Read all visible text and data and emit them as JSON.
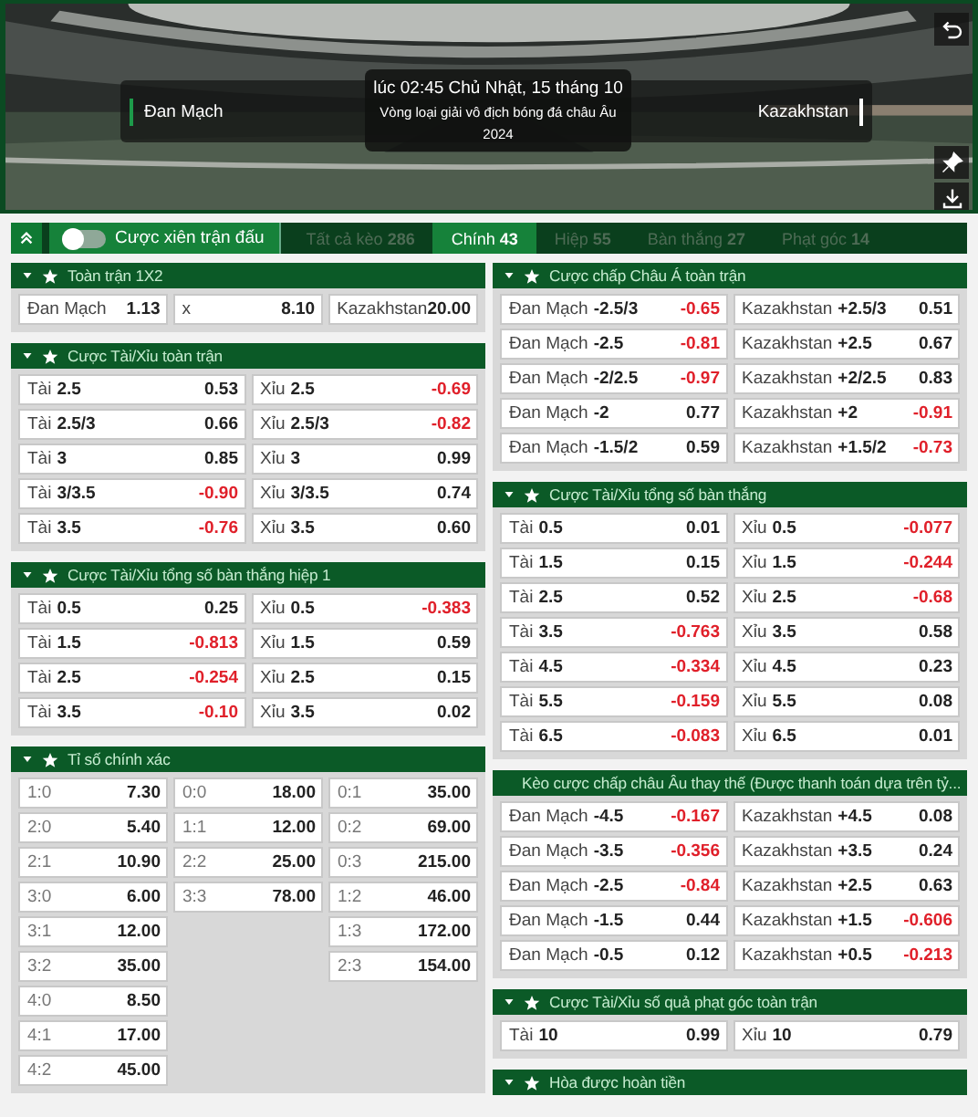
{
  "match": {
    "home": "Đan Mạch",
    "away": "Kazakhstan",
    "time": "lúc 02:45 Chủ Nhật, 15 tháng 10",
    "competition": "Vòng loại giải vô địch bóng đá châu Âu",
    "season": "2024"
  },
  "toolbar": {
    "parlay_label": "Cược xiên trận đấu",
    "parlay_on": false
  },
  "tabs": [
    {
      "label": "Tất cả kèo",
      "count": "286",
      "selected": false
    },
    {
      "label": "Chính",
      "count": "43",
      "selected": true
    },
    {
      "label": "Hiệp",
      "count": "55",
      "selected": false
    },
    {
      "label": "Bàn thắng",
      "count": "27",
      "selected": false
    },
    {
      "label": "Phạt góc",
      "count": "14",
      "selected": false
    }
  ],
  "left_column": [
    {
      "title": "Toàn trận 1X2",
      "kind": "triple",
      "cells": [
        {
          "label": "Đan Mạch",
          "odds": "1.13",
          "negative": false
        },
        {
          "label": "x",
          "odds": "8.10",
          "negative": false
        },
        {
          "label": "Kazakhstan",
          "odds": "20.00",
          "negative": false
        }
      ]
    },
    {
      "title": "Cược Tài/Xỉu toàn trận",
      "kind": "pair",
      "cells": [
        {
          "label": "Tài",
          "line": "2.5",
          "odds": "0.53",
          "negative": false
        },
        {
          "label": "Xỉu",
          "line": "2.5",
          "odds": "-0.69",
          "negative": true
        },
        {
          "label": "Tài",
          "line": "2.5/3",
          "odds": "0.66",
          "negative": false
        },
        {
          "label": "Xỉu",
          "line": "2.5/3",
          "odds": "-0.82",
          "negative": true
        },
        {
          "label": "Tài",
          "line": "3",
          "odds": "0.85",
          "negative": false
        },
        {
          "label": "Xỉu",
          "line": "3",
          "odds": "0.99",
          "negative": false
        },
        {
          "label": "Tài",
          "line": "3/3.5",
          "odds": "-0.90",
          "negative": true
        },
        {
          "label": "Xỉu",
          "line": "3/3.5",
          "odds": "0.74",
          "negative": false
        },
        {
          "label": "Tài",
          "line": "3.5",
          "odds": "-0.76",
          "negative": true
        },
        {
          "label": "Xỉu",
          "line": "3.5",
          "odds": "0.60",
          "negative": false
        }
      ]
    },
    {
      "title": "Cược Tài/Xỉu tổng số bàn thắng hiệp 1",
      "kind": "pair",
      "cells": [
        {
          "label": "Tài",
          "line": "0.5",
          "odds": "0.25",
          "negative": false
        },
        {
          "label": "Xỉu",
          "line": "0.5",
          "odds": "-0.383",
          "negative": true
        },
        {
          "label": "Tài",
          "line": "1.5",
          "odds": "-0.813",
          "negative": true
        },
        {
          "label": "Xỉu",
          "line": "1.5",
          "odds": "0.59",
          "negative": false
        },
        {
          "label": "Tài",
          "line": "2.5",
          "odds": "-0.254",
          "negative": true
        },
        {
          "label": "Xỉu",
          "line": "2.5",
          "odds": "0.15",
          "negative": false
        },
        {
          "label": "Tài",
          "line": "3.5",
          "odds": "-0.10",
          "negative": true
        },
        {
          "label": "Xỉu",
          "line": "3.5",
          "odds": "0.02",
          "negative": false
        }
      ]
    },
    {
      "title": "Tỉ số chính xác",
      "kind": "score",
      "score_columns": [
        [
          {
            "label": "1:0",
            "odds": "7.30",
            "negative": false
          },
          {
            "label": "2:0",
            "odds": "5.40",
            "negative": false
          },
          {
            "label": "2:1",
            "odds": "10.90",
            "negative": false
          },
          {
            "label": "3:0",
            "odds": "6.00",
            "negative": false
          },
          {
            "label": "3:1",
            "odds": "12.00",
            "negative": false
          },
          {
            "label": "3:2",
            "odds": "35.00",
            "negative": false
          },
          {
            "label": "4:0",
            "odds": "8.50",
            "negative": false
          },
          {
            "label": "4:1",
            "odds": "17.00",
            "negative": false
          },
          {
            "label": "4:2",
            "odds": "45.00",
            "negative": false
          }
        ],
        [
          {
            "label": "0:0",
            "odds": "18.00",
            "negative": false
          },
          {
            "label": "1:1",
            "odds": "12.00",
            "negative": false
          },
          {
            "label": "2:2",
            "odds": "25.00",
            "negative": false
          },
          {
            "label": "3:3",
            "odds": "78.00",
            "negative": false
          }
        ],
        [
          {
            "label": "0:1",
            "odds": "35.00",
            "negative": false
          },
          {
            "label": "0:2",
            "odds": "69.00",
            "negative": false
          },
          {
            "label": "0:3",
            "odds": "215.00",
            "negative": false
          },
          {
            "label": "1:2",
            "odds": "46.00",
            "negative": false
          },
          {
            "label": "1:3",
            "odds": "172.00",
            "negative": false
          },
          {
            "label": "2:3",
            "odds": "154.00",
            "negative": false
          }
        ]
      ]
    }
  ],
  "right_column": [
    {
      "title": "Cược chấp Châu Á toàn trận",
      "kind": "pair",
      "cells": [
        {
          "label": "Đan Mạch",
          "line": "-2.5/3",
          "odds": "-0.65",
          "negative": true
        },
        {
          "label": "Kazakhstan",
          "line": "+2.5/3",
          "odds": "0.51",
          "negative": false
        },
        {
          "label": "Đan Mạch",
          "line": "-2.5",
          "odds": "-0.81",
          "negative": true
        },
        {
          "label": "Kazakhstan",
          "line": "+2.5",
          "odds": "0.67",
          "negative": false
        },
        {
          "label": "Đan Mạch",
          "line": "-2/2.5",
          "odds": "-0.97",
          "negative": true
        },
        {
          "label": "Kazakhstan",
          "line": "+2/2.5",
          "odds": "0.83",
          "negative": false
        },
        {
          "label": "Đan Mạch",
          "line": "-2",
          "odds": "0.77",
          "negative": false
        },
        {
          "label": "Kazakhstan",
          "line": "+2",
          "odds": "-0.91",
          "negative": true
        },
        {
          "label": "Đan Mạch",
          "line": "-1.5/2",
          "odds": "0.59",
          "negative": false
        },
        {
          "label": "Kazakhstan",
          "line": "+1.5/2",
          "odds": "-0.73",
          "negative": true
        }
      ]
    },
    {
      "title": "Cược Tài/Xỉu tổng số bàn thắng",
      "kind": "pair",
      "cells": [
        {
          "label": "Tài",
          "line": "0.5",
          "odds": "0.01",
          "negative": false
        },
        {
          "label": "Xỉu",
          "line": "0.5",
          "odds": "-0.077",
          "negative": true
        },
        {
          "label": "Tài",
          "line": "1.5",
          "odds": "0.15",
          "negative": false
        },
        {
          "label": "Xỉu",
          "line": "1.5",
          "odds": "-0.244",
          "negative": true
        },
        {
          "label": "Tài",
          "line": "2.5",
          "odds": "0.52",
          "negative": false
        },
        {
          "label": "Xỉu",
          "line": "2.5",
          "odds": "-0.68",
          "negative": true
        },
        {
          "label": "Tài",
          "line": "3.5",
          "odds": "-0.763",
          "negative": true
        },
        {
          "label": "Xỉu",
          "line": "3.5",
          "odds": "0.58",
          "negative": false
        },
        {
          "label": "Tài",
          "line": "4.5",
          "odds": "-0.334",
          "negative": true
        },
        {
          "label": "Xỉu",
          "line": "4.5",
          "odds": "0.23",
          "negative": false
        },
        {
          "label": "Tài",
          "line": "5.5",
          "odds": "-0.159",
          "negative": true
        },
        {
          "label": "Xỉu",
          "line": "5.5",
          "odds": "0.08",
          "negative": false
        },
        {
          "label": "Tài",
          "line": "6.5",
          "odds": "-0.083",
          "negative": true
        },
        {
          "label": "Xỉu",
          "line": "6.5",
          "odds": "0.01",
          "negative": false
        }
      ]
    },
    {
      "title": "Kèo cược chấp châu Âu thay thế (Được thanh toán dựa trên tỷ...",
      "kind": "pair",
      "cells": [
        {
          "label": "Đan Mạch",
          "line": "-4.5",
          "odds": "-0.167",
          "negative": true
        },
        {
          "label": "Kazakhstan",
          "line": "+4.5",
          "odds": "0.08",
          "negative": false
        },
        {
          "label": "Đan Mạch",
          "line": "-3.5",
          "odds": "-0.356",
          "negative": true
        },
        {
          "label": "Kazakhstan",
          "line": "+3.5",
          "odds": "0.24",
          "negative": false
        },
        {
          "label": "Đan Mạch",
          "line": "-2.5",
          "odds": "-0.84",
          "negative": true
        },
        {
          "label": "Kazakhstan",
          "line": "+2.5",
          "odds": "0.63",
          "negative": false
        },
        {
          "label": "Đan Mạch",
          "line": "-1.5",
          "odds": "0.44",
          "negative": false
        },
        {
          "label": "Kazakhstan",
          "line": "+1.5",
          "odds": "-0.606",
          "negative": true
        },
        {
          "label": "Đan Mạch",
          "line": "-0.5",
          "odds": "0.12",
          "negative": false
        },
        {
          "label": "Kazakhstan",
          "line": "+0.5",
          "odds": "-0.213",
          "negative": true
        }
      ]
    },
    {
      "title": "Cược Tài/Xỉu số quả phạt góc toàn trận",
      "kind": "pair",
      "cells": [
        {
          "label": "Tài",
          "line": "10",
          "odds": "0.99",
          "negative": false
        },
        {
          "label": "Xỉu",
          "line": "10",
          "odds": "0.79",
          "negative": false
        }
      ]
    },
    {
      "title": "Hòa được hoàn tiền",
      "kind": "pair"
    }
  ]
}
